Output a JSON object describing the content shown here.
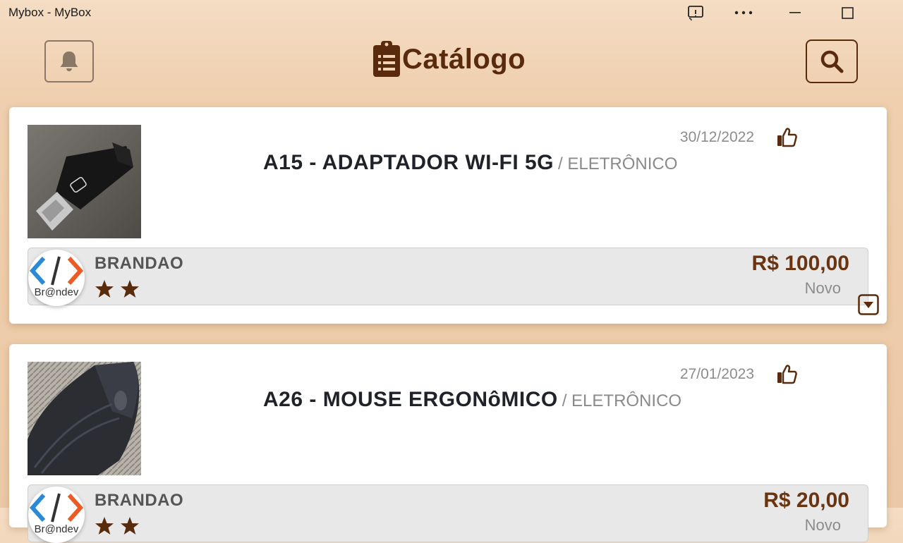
{
  "window": {
    "title": "Mybox - MyBox"
  },
  "header": {
    "title": "Catálogo",
    "icons": {
      "left": "bell-icon",
      "title": "clipboard-list-icon",
      "right": "search-icon"
    }
  },
  "colors": {
    "brand": "#5a2a0c",
    "price": "#6b3410",
    "background": "#efcfae"
  },
  "products": [
    {
      "date": "30/12/2022",
      "name": "A15 - ADAPTADOR WI-FI 5G",
      "category": "/ ELETRÔNICO",
      "seller": "BRANDAO",
      "seller_logo_text": "Br@ndev",
      "rating": 2,
      "price": "R$ 100,00",
      "condition": "Novo"
    },
    {
      "date": "27/01/2023",
      "name": "A26 - MOUSE ERGONôMICO",
      "category": "/ ELETRÔNICO",
      "seller": "BRANDAO",
      "seller_logo_text": "Br@ndev",
      "rating": 2,
      "price": "R$ 20,00",
      "condition": "Novo"
    }
  ]
}
